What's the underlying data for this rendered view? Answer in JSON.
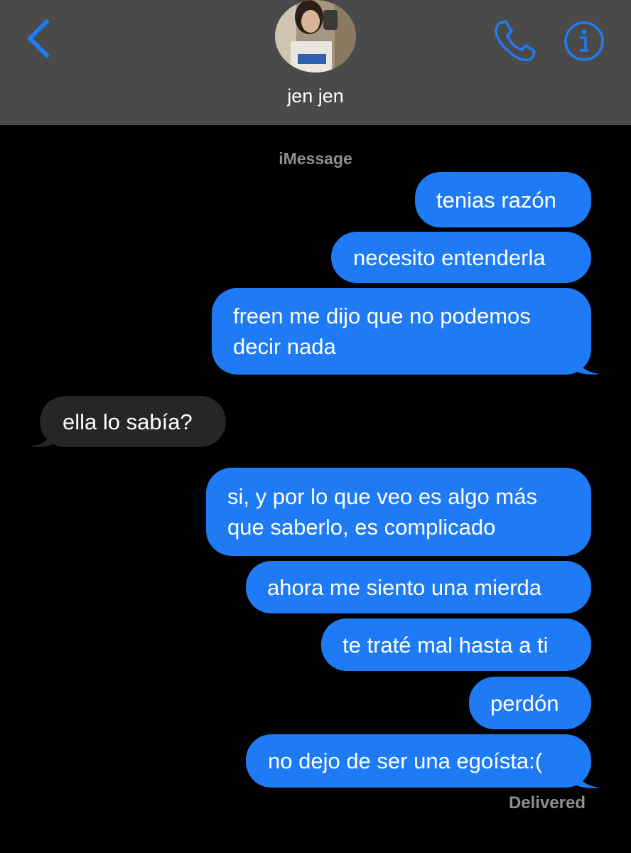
{
  "header": {
    "contact_name": "jen jen",
    "back_icon": "chevron-left-icon",
    "call_icon": "phone-icon",
    "info_icon": "info-icon",
    "accent_color": "#1e7bf5"
  },
  "conversation": {
    "service_label": "iMessage",
    "messages": [
      {
        "direction": "outgoing",
        "text": "tenias razón"
      },
      {
        "direction": "outgoing",
        "text": "necesito entenderla"
      },
      {
        "direction": "outgoing",
        "line1": "freen me dijo que no podemos",
        "line2": "decir nada"
      },
      {
        "direction": "incoming",
        "text": "ella lo sabía?"
      },
      {
        "direction": "outgoing",
        "line1": "si, y por lo que veo es algo más",
        "line2": "que saberlo, es complicado"
      },
      {
        "direction": "outgoing",
        "text": "ahora me siento una mierda"
      },
      {
        "direction": "outgoing",
        "text": "te traté mal hasta a ti"
      },
      {
        "direction": "outgoing",
        "text": "perdón"
      },
      {
        "direction": "outgoing",
        "text": "no dejo de ser una egoísta:("
      }
    ],
    "status": "Delivered"
  },
  "colors": {
    "outgoing_bubble": "#1e7bf5",
    "incoming_bubble": "#262629",
    "header_bg": "#4a4a4a",
    "background": "#000000"
  }
}
